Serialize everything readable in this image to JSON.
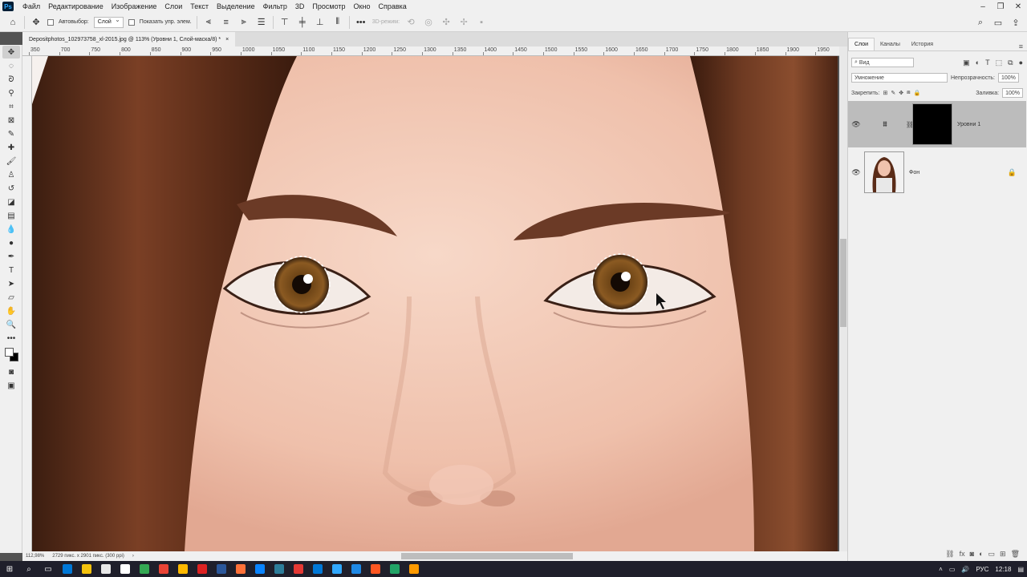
{
  "app": {
    "logo": "Ps"
  },
  "menu": [
    "Файл",
    "Редактирование",
    "Изображение",
    "Слои",
    "Текст",
    "Выделение",
    "Фильтр",
    "3D",
    "Просмотр",
    "Окно",
    "Справка"
  ],
  "options": {
    "autoselect_label": "Автовыбор:",
    "autoselect_value": "Слой",
    "show_controls_label": "Показать упр. элем.",
    "mode3d_label": "3D-режим:"
  },
  "document": {
    "tab_title": "Depositphotos_102973758_xl-2015.jpg @ 113% (Уровни 1, Слой-маска/8) *",
    "close": "×"
  },
  "ruler_top": [
    "350",
    "700",
    "750",
    "800",
    "850",
    "900",
    "950",
    "1000",
    "1050",
    "1100",
    "1150",
    "1200",
    "1250",
    "1300",
    "1350",
    "1400",
    "1450",
    "1500",
    "1550",
    "1600",
    "1650",
    "1700",
    "1750",
    "1800",
    "1850",
    "1900",
    "1950"
  ],
  "status": {
    "zoom": "112,98%",
    "size": "2729 пикс. x 2901 пикс. (300 ppi)",
    "arrow": "›"
  },
  "panel": {
    "tabs": [
      "Слои",
      "Каналы",
      "История"
    ],
    "filter_label": "Вид",
    "blend_mode": "Умножение",
    "opacity_label": "Непрозрачность:",
    "opacity_value": "100%",
    "lock_label": "Закрепить:",
    "fill_label": "Заливка:",
    "fill_value": "100%",
    "layers": [
      {
        "name": "Уровни 1",
        "selected": true
      },
      {
        "name": "Фон",
        "selected": false
      }
    ]
  },
  "taskbar": {
    "language": "РУС",
    "time": "12:18",
    "icon_colors": [
      "#0078d7",
      "#f4c20d",
      "#e8e8e8",
      "#ffffff",
      "#34a853",
      "#ea4335",
      "#ffb900",
      "#dd2222",
      "#2b579a",
      "#ff7139",
      "#0a84ff",
      "#2d7d9a",
      "#e53935",
      "#0078d7",
      "#31a8ff",
      "#1e88e5",
      "#ff5722",
      "#21a366",
      "#ff9a00"
    ]
  },
  "colors": {
    "chrome": "#f0f0f0",
    "skin": "#f3c9b6",
    "hair": "#5a2e1c",
    "iris": "#7a4a1a"
  }
}
